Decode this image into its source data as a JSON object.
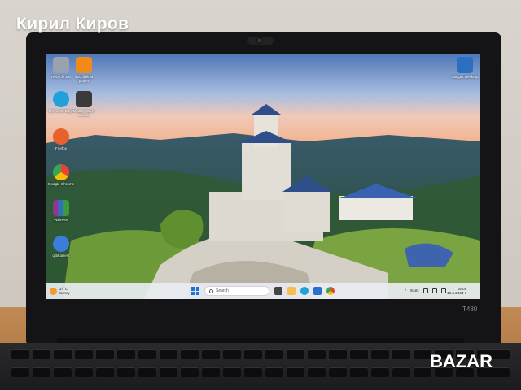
{
  "watermark": {
    "seller_name": "Кирил Киров",
    "site": "BAZAR"
  },
  "laptop": {
    "model": "T480"
  },
  "desktop": {
    "icons": [
      {
        "label": "Recycle Bin",
        "color": "#9aa3ad"
      },
      {
        "label": "VLC media player",
        "color": "#f08a1a"
      },
      {
        "label": "Microsoft Edge",
        "color": "#1fa1d9"
      },
      {
        "label": "Media Player Classic",
        "color": "#3a3a3a"
      },
      {
        "label": "Firefox",
        "color": "#e8612c"
      },
      {
        "label": "Google Chrome",
        "color": "#34a853"
      },
      {
        "label": "WinRAR",
        "color": "#8b3a8b"
      },
      {
        "label": "qBittorrent",
        "color": "#3b7dd8"
      },
      {
        "label": "Gadget Desktop",
        "color": "#2a6fc2"
      }
    ]
  },
  "taskbar": {
    "weather_temp": "24°C",
    "weather_desc": "Sunny",
    "search_placeholder": "Search",
    "language": "ENG",
    "clock_time": "18:01",
    "clock_date": "10.6.2024 г."
  }
}
